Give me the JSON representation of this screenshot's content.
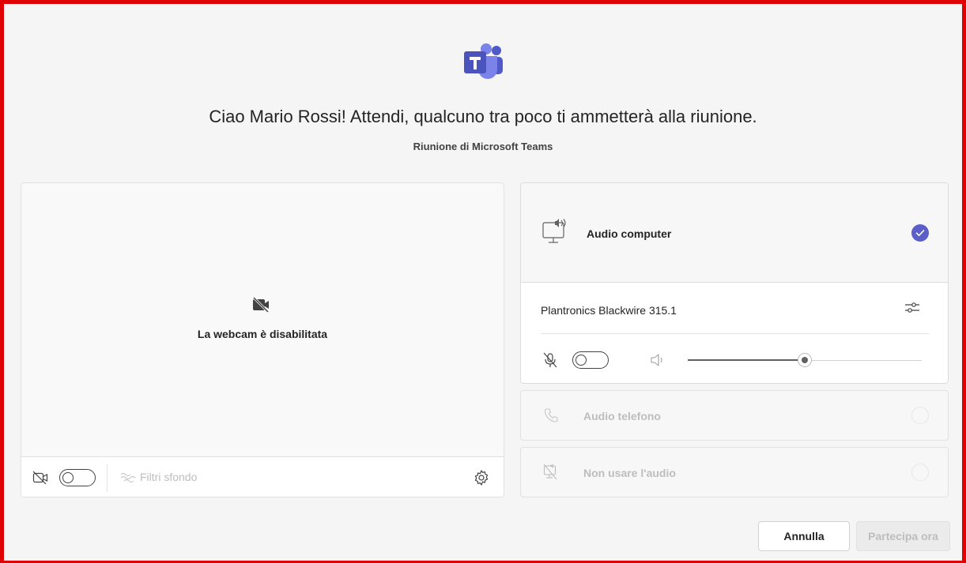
{
  "app": {
    "logo_icon": "microsoft-teams-logo",
    "greeting": "Ciao Mario Rossi! Attendi, qualcuno tra poco ti ammetterà alla riunione.",
    "meeting_type": "Riunione di Microsoft Teams"
  },
  "video": {
    "camera_off_icon": "camera-off-icon",
    "camera_off_message": "La webcam è disabilitata",
    "camera_toggle_on": false,
    "background_filters_label": "Filtri sfondo",
    "settings_icon": "gear-icon"
  },
  "audio": {
    "computer_audio": {
      "label": "Audio computer",
      "icon": "computer-speaker-icon",
      "selected": true
    },
    "device_name": "Plantronics Blackwire 315.1",
    "mic_toggle_on": false,
    "volume_fraction": 0.5,
    "phone_audio": {
      "label": "Audio telefono",
      "icon": "phone-icon",
      "selected": false
    },
    "no_audio": {
      "label": "Non usare l'audio",
      "icon": "speaker-off-icon",
      "selected": false
    }
  },
  "actions": {
    "cancel_label": "Annulla",
    "join_label": "Partecipa ora"
  },
  "colors": {
    "accent": "#5b5fc7",
    "frame": "#e00000"
  }
}
